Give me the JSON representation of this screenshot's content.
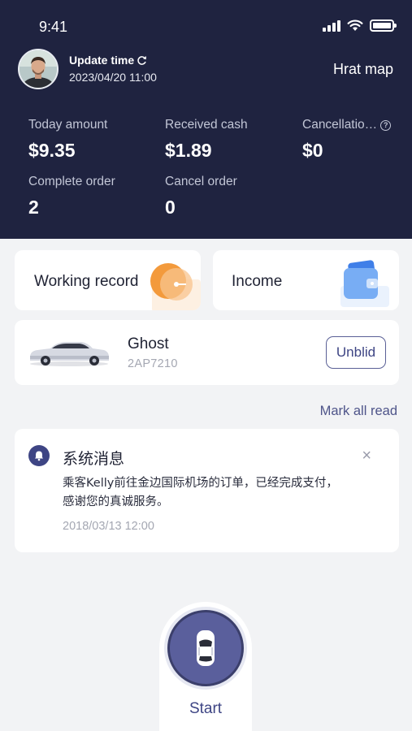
{
  "status_bar": {
    "time": "9:41"
  },
  "header": {
    "update_label": "Update time",
    "update_date": "2023/04/20 11:00",
    "heat_map_label": "Hrat map",
    "stats": [
      {
        "label": "Today amount",
        "value": "$9.35"
      },
      {
        "label": "Received cash",
        "value": "$1.89"
      },
      {
        "label": "Cancellatio…",
        "value": "$0"
      },
      {
        "label": "Complete order",
        "value": "2"
      },
      {
        "label": "Cancel order",
        "value": "0"
      }
    ]
  },
  "shortcuts": {
    "working_record": "Working record",
    "income": "Income"
  },
  "vehicle": {
    "name": "Ghost",
    "plate": "2AP7210",
    "unbind_label": "Unblid"
  },
  "messages": {
    "mark_all_read": "Mark all read",
    "items": [
      {
        "title": "系统消息",
        "body": "乘客Kelly前往金边国际机场的订单，已经完成支付，感谢您的真诚服务。",
        "time": "2018/03/13 12:00"
      }
    ]
  },
  "start": {
    "label": "Start"
  },
  "colors": {
    "header_bg": "#1f2340",
    "accent": "#3e4584",
    "start_button": "#5a5f9c",
    "orange": "#f39a3c",
    "blue": "#4a8ef0"
  }
}
